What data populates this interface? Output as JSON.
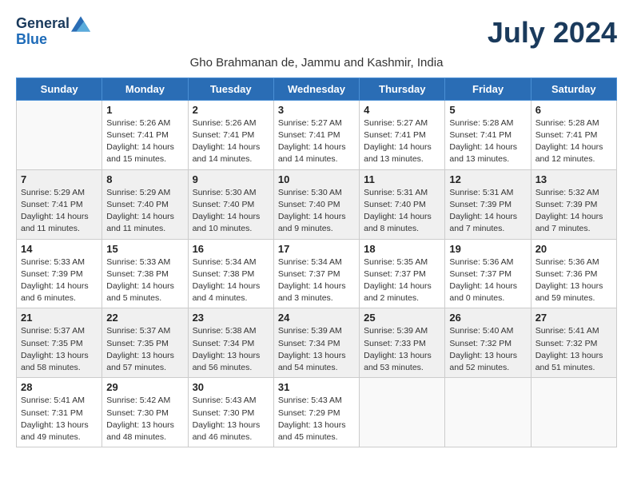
{
  "logo": {
    "general": "General",
    "blue": "Blue"
  },
  "title": "July 2024",
  "location": "Gho Brahmanan de, Jammu and Kashmir, India",
  "weekdays": [
    "Sunday",
    "Monday",
    "Tuesday",
    "Wednesday",
    "Thursday",
    "Friday",
    "Saturday"
  ],
  "weeks": [
    [
      {
        "day": "",
        "info": ""
      },
      {
        "day": "1",
        "info": "Sunrise: 5:26 AM\nSunset: 7:41 PM\nDaylight: 14 hours\nand 15 minutes."
      },
      {
        "day": "2",
        "info": "Sunrise: 5:26 AM\nSunset: 7:41 PM\nDaylight: 14 hours\nand 14 minutes."
      },
      {
        "day": "3",
        "info": "Sunrise: 5:27 AM\nSunset: 7:41 PM\nDaylight: 14 hours\nand 14 minutes."
      },
      {
        "day": "4",
        "info": "Sunrise: 5:27 AM\nSunset: 7:41 PM\nDaylight: 14 hours\nand 13 minutes."
      },
      {
        "day": "5",
        "info": "Sunrise: 5:28 AM\nSunset: 7:41 PM\nDaylight: 14 hours\nand 13 minutes."
      },
      {
        "day": "6",
        "info": "Sunrise: 5:28 AM\nSunset: 7:41 PM\nDaylight: 14 hours\nand 12 minutes."
      }
    ],
    [
      {
        "day": "7",
        "info": "Sunrise: 5:29 AM\nSunset: 7:41 PM\nDaylight: 14 hours\nand 11 minutes."
      },
      {
        "day": "8",
        "info": "Sunrise: 5:29 AM\nSunset: 7:40 PM\nDaylight: 14 hours\nand 11 minutes."
      },
      {
        "day": "9",
        "info": "Sunrise: 5:30 AM\nSunset: 7:40 PM\nDaylight: 14 hours\nand 10 minutes."
      },
      {
        "day": "10",
        "info": "Sunrise: 5:30 AM\nSunset: 7:40 PM\nDaylight: 14 hours\nand 9 minutes."
      },
      {
        "day": "11",
        "info": "Sunrise: 5:31 AM\nSunset: 7:40 PM\nDaylight: 14 hours\nand 8 minutes."
      },
      {
        "day": "12",
        "info": "Sunrise: 5:31 AM\nSunset: 7:39 PM\nDaylight: 14 hours\nand 7 minutes."
      },
      {
        "day": "13",
        "info": "Sunrise: 5:32 AM\nSunset: 7:39 PM\nDaylight: 14 hours\nand 7 minutes."
      }
    ],
    [
      {
        "day": "14",
        "info": "Sunrise: 5:33 AM\nSunset: 7:39 PM\nDaylight: 14 hours\nand 6 minutes."
      },
      {
        "day": "15",
        "info": "Sunrise: 5:33 AM\nSunset: 7:38 PM\nDaylight: 14 hours\nand 5 minutes."
      },
      {
        "day": "16",
        "info": "Sunrise: 5:34 AM\nSunset: 7:38 PM\nDaylight: 14 hours\nand 4 minutes."
      },
      {
        "day": "17",
        "info": "Sunrise: 5:34 AM\nSunset: 7:37 PM\nDaylight: 14 hours\nand 3 minutes."
      },
      {
        "day": "18",
        "info": "Sunrise: 5:35 AM\nSunset: 7:37 PM\nDaylight: 14 hours\nand 2 minutes."
      },
      {
        "day": "19",
        "info": "Sunrise: 5:36 AM\nSunset: 7:37 PM\nDaylight: 14 hours\nand 0 minutes."
      },
      {
        "day": "20",
        "info": "Sunrise: 5:36 AM\nSunset: 7:36 PM\nDaylight: 13 hours\nand 59 minutes."
      }
    ],
    [
      {
        "day": "21",
        "info": "Sunrise: 5:37 AM\nSunset: 7:35 PM\nDaylight: 13 hours\nand 58 minutes."
      },
      {
        "day": "22",
        "info": "Sunrise: 5:37 AM\nSunset: 7:35 PM\nDaylight: 13 hours\nand 57 minutes."
      },
      {
        "day": "23",
        "info": "Sunrise: 5:38 AM\nSunset: 7:34 PM\nDaylight: 13 hours\nand 56 minutes."
      },
      {
        "day": "24",
        "info": "Sunrise: 5:39 AM\nSunset: 7:34 PM\nDaylight: 13 hours\nand 54 minutes."
      },
      {
        "day": "25",
        "info": "Sunrise: 5:39 AM\nSunset: 7:33 PM\nDaylight: 13 hours\nand 53 minutes."
      },
      {
        "day": "26",
        "info": "Sunrise: 5:40 AM\nSunset: 7:32 PM\nDaylight: 13 hours\nand 52 minutes."
      },
      {
        "day": "27",
        "info": "Sunrise: 5:41 AM\nSunset: 7:32 PM\nDaylight: 13 hours\nand 51 minutes."
      }
    ],
    [
      {
        "day": "28",
        "info": "Sunrise: 5:41 AM\nSunset: 7:31 PM\nDaylight: 13 hours\nand 49 minutes."
      },
      {
        "day": "29",
        "info": "Sunrise: 5:42 AM\nSunset: 7:30 PM\nDaylight: 13 hours\nand 48 minutes."
      },
      {
        "day": "30",
        "info": "Sunrise: 5:43 AM\nSunset: 7:30 PM\nDaylight: 13 hours\nand 46 minutes."
      },
      {
        "day": "31",
        "info": "Sunrise: 5:43 AM\nSunset: 7:29 PM\nDaylight: 13 hours\nand 45 minutes."
      },
      {
        "day": "",
        "info": ""
      },
      {
        "day": "",
        "info": ""
      },
      {
        "day": "",
        "info": ""
      }
    ]
  ]
}
